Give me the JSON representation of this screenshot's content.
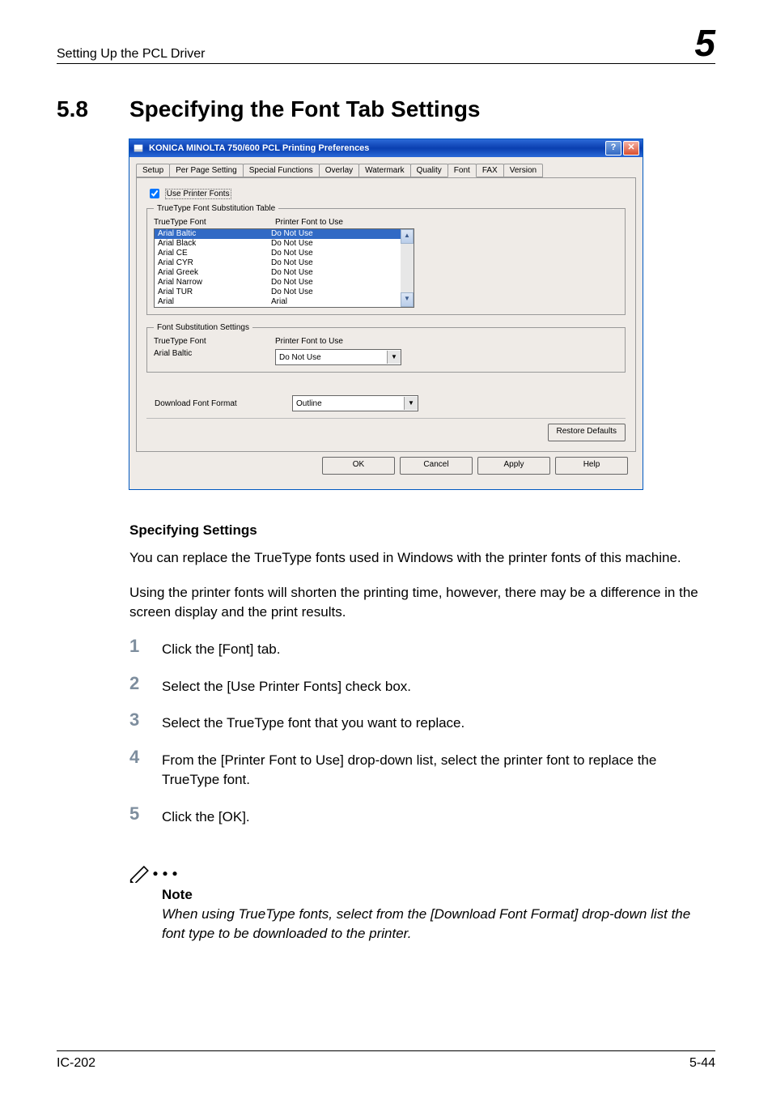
{
  "header": {
    "section_path": "Setting Up the PCL Driver",
    "chapter_number": "5"
  },
  "section": {
    "number": "5.8",
    "title": "Specifying the Font Tab Settings"
  },
  "dialog": {
    "title": "KONICA MINOLTA 750/600 PCL Printing Preferences",
    "tabs": [
      "Setup",
      "Per Page Setting",
      "Special Functions",
      "Overlay",
      "Watermark",
      "Quality",
      "Font",
      "FAX",
      "Version"
    ],
    "active_tab": "Font",
    "use_printer_fonts_label": "Use Printer Fonts",
    "use_printer_fonts_checked": true,
    "truetype_table_legend": "TrueType Font Substitution Table",
    "col_truetype": "TrueType Font",
    "col_printerfont": "Printer Font to Use",
    "font_rows": [
      {
        "tt": "Arial Baltic",
        "pf": "Do Not Use",
        "selected": true
      },
      {
        "tt": "Arial Black",
        "pf": "Do Not Use",
        "selected": false
      },
      {
        "tt": "Arial CE",
        "pf": "Do Not Use",
        "selected": false
      },
      {
        "tt": "Arial CYR",
        "pf": "Do Not Use",
        "selected": false
      },
      {
        "tt": "Arial Greek",
        "pf": "Do Not Use",
        "selected": false
      },
      {
        "tt": "Arial Narrow",
        "pf": "Do Not Use",
        "selected": false
      },
      {
        "tt": "Arial TUR",
        "pf": "Do Not Use",
        "selected": false
      },
      {
        "tt": "Arial",
        "pf": "Arial",
        "selected": false
      }
    ],
    "subst_legend": "Font Substitution Settings",
    "subst_tt_label": "TrueType Font",
    "subst_pf_label": "Printer Font to Use",
    "subst_tt_value": "Arial Baltic",
    "subst_pf_value": "Do Not Use",
    "download_label": "Download Font Format",
    "download_value": "Outline",
    "restore_defaults": "Restore Defaults",
    "buttons": {
      "ok": "OK",
      "cancel": "Cancel",
      "apply": "Apply",
      "help": "Help"
    }
  },
  "body": {
    "subheading": "Specifying Settings",
    "para1": "You can replace the TrueType fonts used in Windows with the printer fonts of this machine.",
    "para2": "Using the printer fonts will shorten the printing time, however, there may be a difference in the screen display and the print results.",
    "steps": [
      "Click the [Font] tab.",
      "Select the [Use Printer Fonts] check box.",
      "Select the TrueType font that you want to replace.",
      "From the [Printer Font to Use] drop-down list, select the printer font to replace the TrueType font.",
      "Click the [OK]."
    ],
    "note_label": "Note",
    "note_text": "When using TrueType fonts, select from the [Download Font Format] drop-down list the font type to be downloaded to the printer."
  },
  "footer": {
    "left": "IC-202",
    "right": "5-44"
  }
}
